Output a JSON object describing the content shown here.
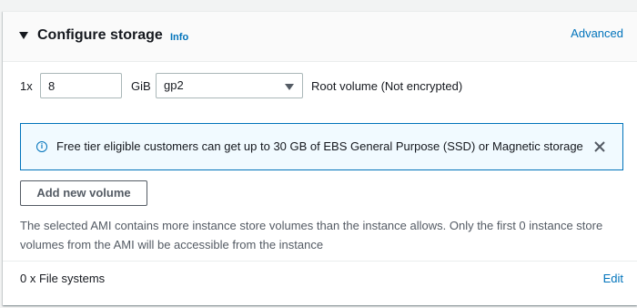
{
  "section": {
    "title": "Configure storage",
    "info_link": "Info",
    "advanced_link": "Advanced"
  },
  "volume": {
    "quantity_label": "1x",
    "size_value": "8",
    "size_unit": "GiB",
    "type_selected": "gp2",
    "description": "Root volume  (Not encrypted)"
  },
  "alert": {
    "icon": "info-icon",
    "message": "Free tier eligible customers can get up to 30 GB of EBS General Purpose (SSD) or Magnetic storage",
    "color": "#0073bb"
  },
  "actions": {
    "add_volume_label": "Add new volume"
  },
  "warning": "The selected AMI contains more instance store volumes than the instance allows. Only the first 0 instance store volumes from the AMI will be accessible from the instance",
  "file_systems": {
    "label": "0 x File systems",
    "edit_link": "Edit"
  }
}
